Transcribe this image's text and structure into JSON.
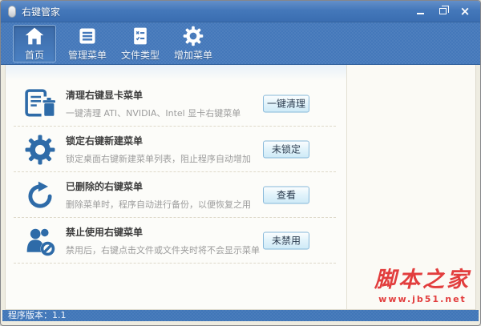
{
  "window": {
    "title": "右键管家",
    "controls": {
      "close_glyph": "×"
    }
  },
  "toolbar": {
    "items": [
      {
        "label": "首页",
        "icon": "home-icon",
        "active": true
      },
      {
        "label": "管理菜单",
        "icon": "menu-list-icon",
        "active": false
      },
      {
        "label": "文件类型",
        "icon": "file-type-icon",
        "active": false
      },
      {
        "label": "增加菜单",
        "icon": "add-menu-gear-icon",
        "active": false
      }
    ]
  },
  "content": {
    "rows": [
      {
        "icon": "clean-gpu-menu-icon",
        "title": "清理右键显卡菜单",
        "description": "一键清理 ATI、NVIDIA、Intel 显卡右键菜单",
        "button": "一键清理"
      },
      {
        "icon": "lock-new-menu-icon",
        "title": "锁定右键新建菜单",
        "description": "锁定桌面右键新建菜单列表，阻止程序自动增加",
        "button": "未锁定"
      },
      {
        "icon": "deleted-menu-backup-icon",
        "title": "已删除的右键菜单",
        "description": "删除菜单时，程序自动进行备份，以便恢复之用",
        "button": "查看"
      },
      {
        "icon": "disable-context-menu-icon",
        "title": "禁止使用右键菜单",
        "description": "禁用后，右键点击文件或文件夹时将不会显示菜单",
        "button": "未禁用"
      }
    ]
  },
  "statusbar": {
    "version": "程序版本：1.1"
  },
  "watermark": {
    "site_name": "脚本之家",
    "site_url": "www.jb51.net"
  },
  "colors": {
    "titlebar_blue": "#4478ba",
    "toolbar_blue": "#4478ba",
    "icon_blue": "#2e6ba8",
    "button_border": "#85b7d9",
    "button_face": "#dff1fa",
    "watermark_red": "#e23d3d"
  }
}
